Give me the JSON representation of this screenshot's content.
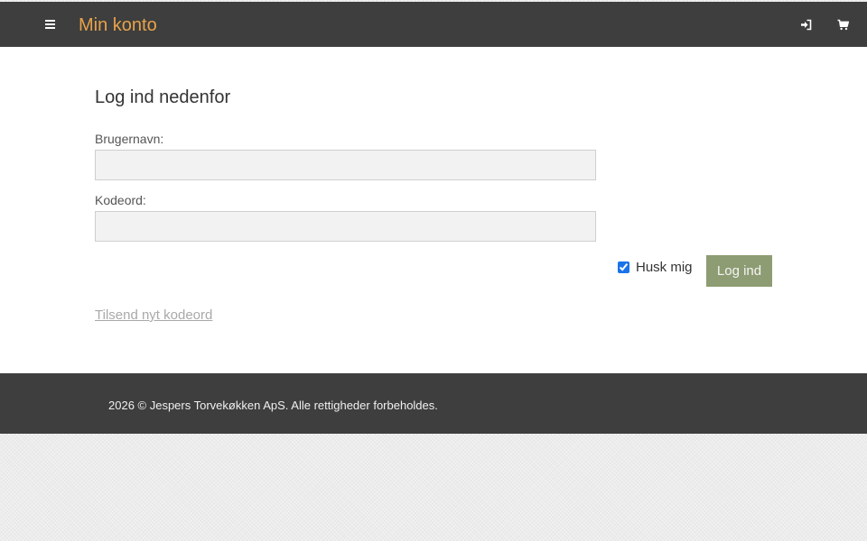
{
  "header": {
    "title": "Min konto",
    "icons": {
      "menu": "hamburger-menu-icon",
      "login": "sign-in-icon",
      "cart": "shopping-cart-icon"
    }
  },
  "login_form": {
    "heading": "Log ind nedenfor",
    "username_label": "Brugernavn:",
    "username_value": "",
    "password_label": "Kodeord:",
    "password_value": "",
    "remember_label": "Husk mig",
    "remember_checked": true,
    "submit_label": "Log ind",
    "forgot_link": "Tilsend nyt kodeord"
  },
  "footer": {
    "copyright": "2026 © Jespers Torvekøkken ApS. Alle rettigheder forbeholdes."
  },
  "colors": {
    "header_bg": "#3d3e3d",
    "brand": "#e9a24b",
    "button_bg": "#8d9c72",
    "link": "#a9a9a9"
  }
}
